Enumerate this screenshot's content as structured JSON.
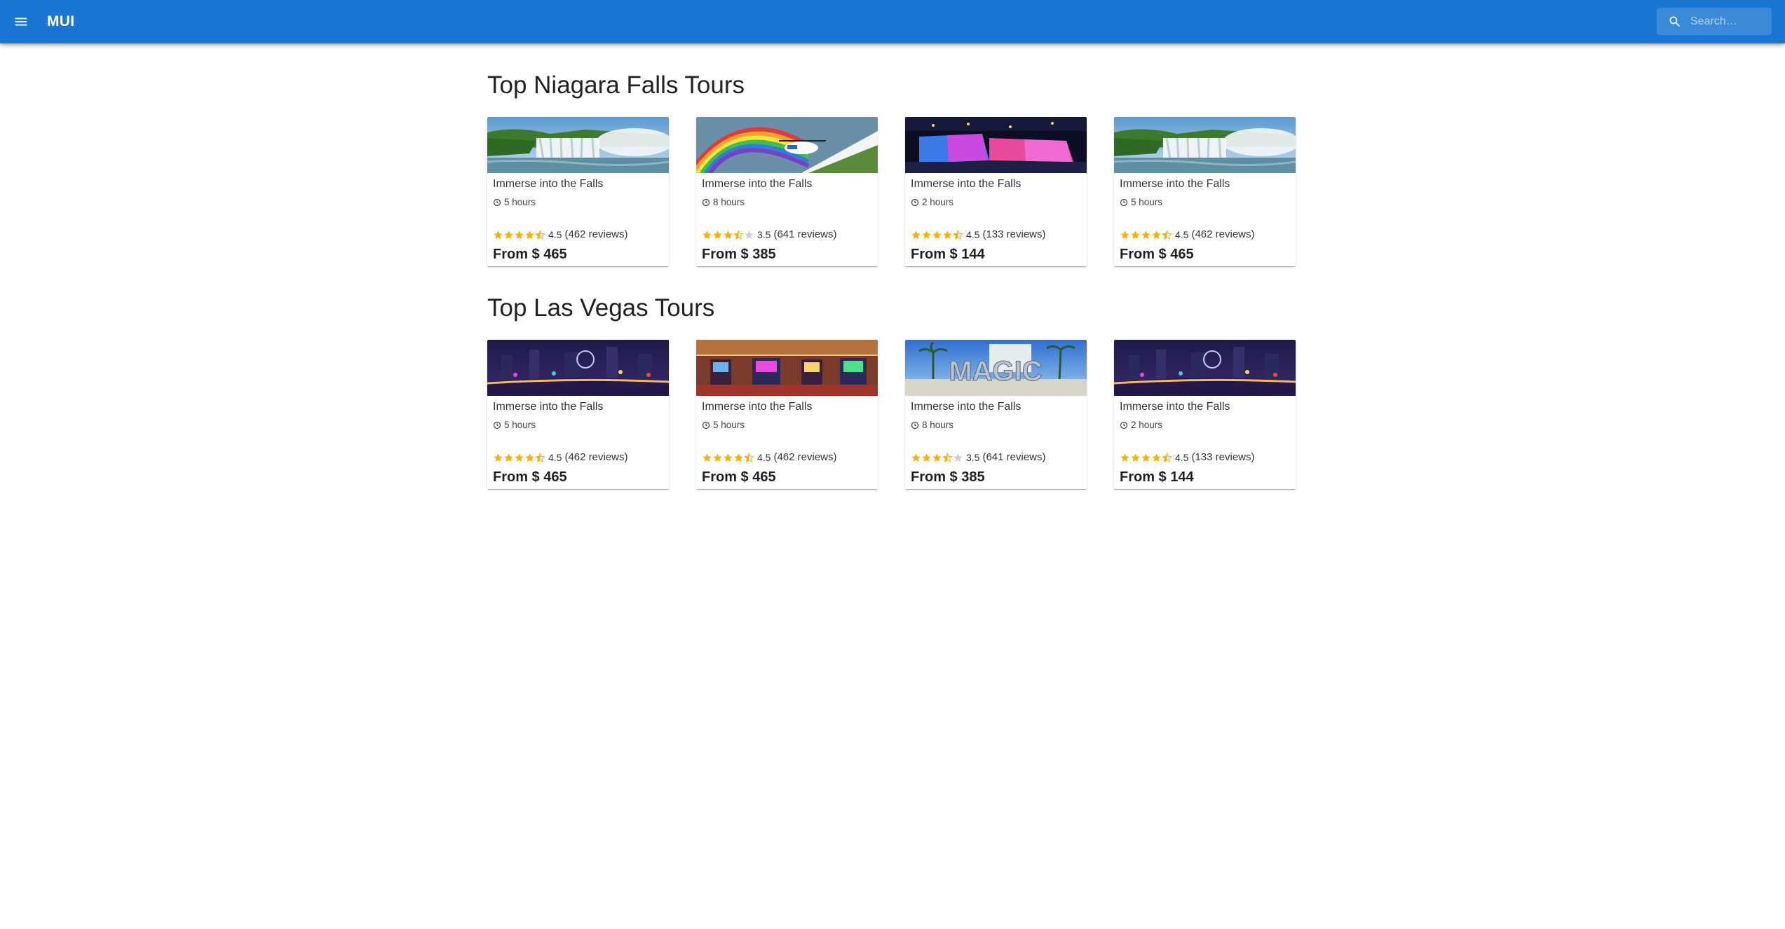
{
  "app": {
    "title": "MUI",
    "menu_icon": "menu-icon",
    "search": {
      "placeholder": "Search…",
      "value": "",
      "icon": "search-icon"
    },
    "colors": {
      "appbar": "#1976d2",
      "star": "#faaf00"
    }
  },
  "sections": [
    {
      "title": "Top Niagara Falls Tours",
      "tours": [
        {
          "name": "Immerse into the Falls",
          "duration": "5 hours",
          "rating": 4.5,
          "rating_text": "4.5",
          "reviews": "(462 reviews)",
          "price": "From $ 465",
          "image": "falls-daytime"
        },
        {
          "name": "Immerse into the Falls",
          "duration": "8 hours",
          "rating": 3.5,
          "rating_text": "3.5",
          "reviews": "(641 reviews)",
          "price": "From $ 385",
          "image": "falls-helicopter-rainbow"
        },
        {
          "name": "Immerse into the Falls",
          "duration": "2 hours",
          "rating": 4.5,
          "rating_text": "4.5",
          "reviews": "(133 reviews)",
          "price": "From $ 144",
          "image": "falls-illuminated-night"
        },
        {
          "name": "Immerse into the Falls",
          "duration": "5 hours",
          "rating": 4.5,
          "rating_text": "4.5",
          "reviews": "(462 reviews)",
          "price": "From $ 465",
          "image": "falls-daytime"
        }
      ]
    },
    {
      "title": "Top Las Vegas Tours",
      "tours": [
        {
          "name": "Immerse into the Falls",
          "duration": "5 hours",
          "rating": 4.5,
          "rating_text": "4.5",
          "reviews": "(462 reviews)",
          "price": "From $ 465",
          "image": "vegas-strip-night"
        },
        {
          "name": "Immerse into the Falls",
          "duration": "5 hours",
          "rating": 4.5,
          "rating_text": "4.5",
          "reviews": "(462 reviews)",
          "price": "From $ 465",
          "image": "casino-floor"
        },
        {
          "name": "Immerse into the Falls",
          "duration": "8 hours",
          "rating": 3.5,
          "rating_text": "3.5",
          "reviews": "(641 reviews)",
          "price": "From $ 385",
          "image": "magic-sign"
        },
        {
          "name": "Immerse into the Falls",
          "duration": "2 hours",
          "rating": 4.5,
          "rating_text": "4.5",
          "reviews": "(133 reviews)",
          "price": "From $ 144",
          "image": "vegas-strip-night"
        }
      ]
    }
  ]
}
